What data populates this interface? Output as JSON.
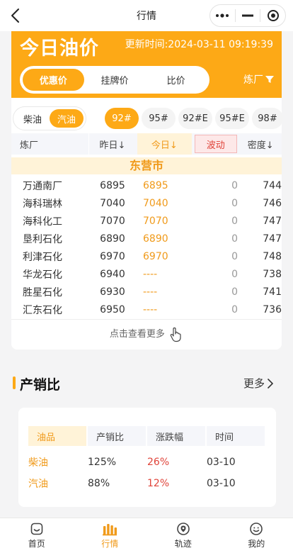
{
  "nav": {
    "title": "行情"
  },
  "hero": {
    "title": "今日油价",
    "update_time": "更新时间:2024-03-11 09:19:39",
    "segments": [
      "优惠价",
      "挂牌价",
      "比价"
    ],
    "active_segment": 0,
    "refinery_label": "炼厂"
  },
  "panel": {
    "fuel_types": [
      "柴油",
      "汽油"
    ],
    "active_fuel": 1,
    "grades": [
      "92#",
      "95#",
      "92#E",
      "95#E",
      "98#"
    ],
    "active_grade": 0,
    "columns": [
      "炼厂",
      "昨日↓",
      "今日↓",
      "波动",
      "密度↓"
    ],
    "city": "东营市",
    "rows": [
      {
        "name": "万通南厂",
        "yesterday": "6895",
        "today": "6895",
        "change": "0",
        "density": "744"
      },
      {
        "name": "海科瑞林",
        "yesterday": "7040",
        "today": "7040",
        "change": "0",
        "density": "746"
      },
      {
        "name": "海科化工",
        "yesterday": "7070",
        "today": "7070",
        "change": "0",
        "density": "747"
      },
      {
        "name": "垦利石化",
        "yesterday": "6890",
        "today": "6890",
        "change": "0",
        "density": "747"
      },
      {
        "name": "利津石化",
        "yesterday": "6970",
        "today": "6970",
        "change": "0",
        "density": "748"
      },
      {
        "name": "华龙石化",
        "yesterday": "6940",
        "today": "----",
        "change": "0",
        "density": "738"
      },
      {
        "name": "胜星石化",
        "yesterday": "6930",
        "today": "----",
        "change": "0",
        "density": "741"
      },
      {
        "name": "汇东石化",
        "yesterday": "6950",
        "today": "----",
        "change": "0",
        "density": "736"
      }
    ],
    "more_label": "点击查看更多"
  },
  "ratio": {
    "title": "产销比",
    "more_label": "更多",
    "columns": [
      "油品",
      "产销比",
      "涨跌幅",
      "时间"
    ],
    "rows": [
      {
        "product": "柴油",
        "ratio": "125%",
        "change": "26%",
        "date": "03-10"
      },
      {
        "product": "汽油",
        "ratio": "88%",
        "change": "12%",
        "date": "03-10"
      }
    ]
  },
  "tabbar": {
    "items": [
      {
        "label": "首页",
        "icon": "home-icon"
      },
      {
        "label": "行情",
        "icon": "market-icon"
      },
      {
        "label": "轨迹",
        "icon": "track-icon"
      },
      {
        "label": "我的",
        "icon": "profile-icon"
      }
    ],
    "active": 1
  },
  "colors": {
    "accent": "#fda916",
    "accent_text": "#f09a1a",
    "up": "#e0443a"
  }
}
